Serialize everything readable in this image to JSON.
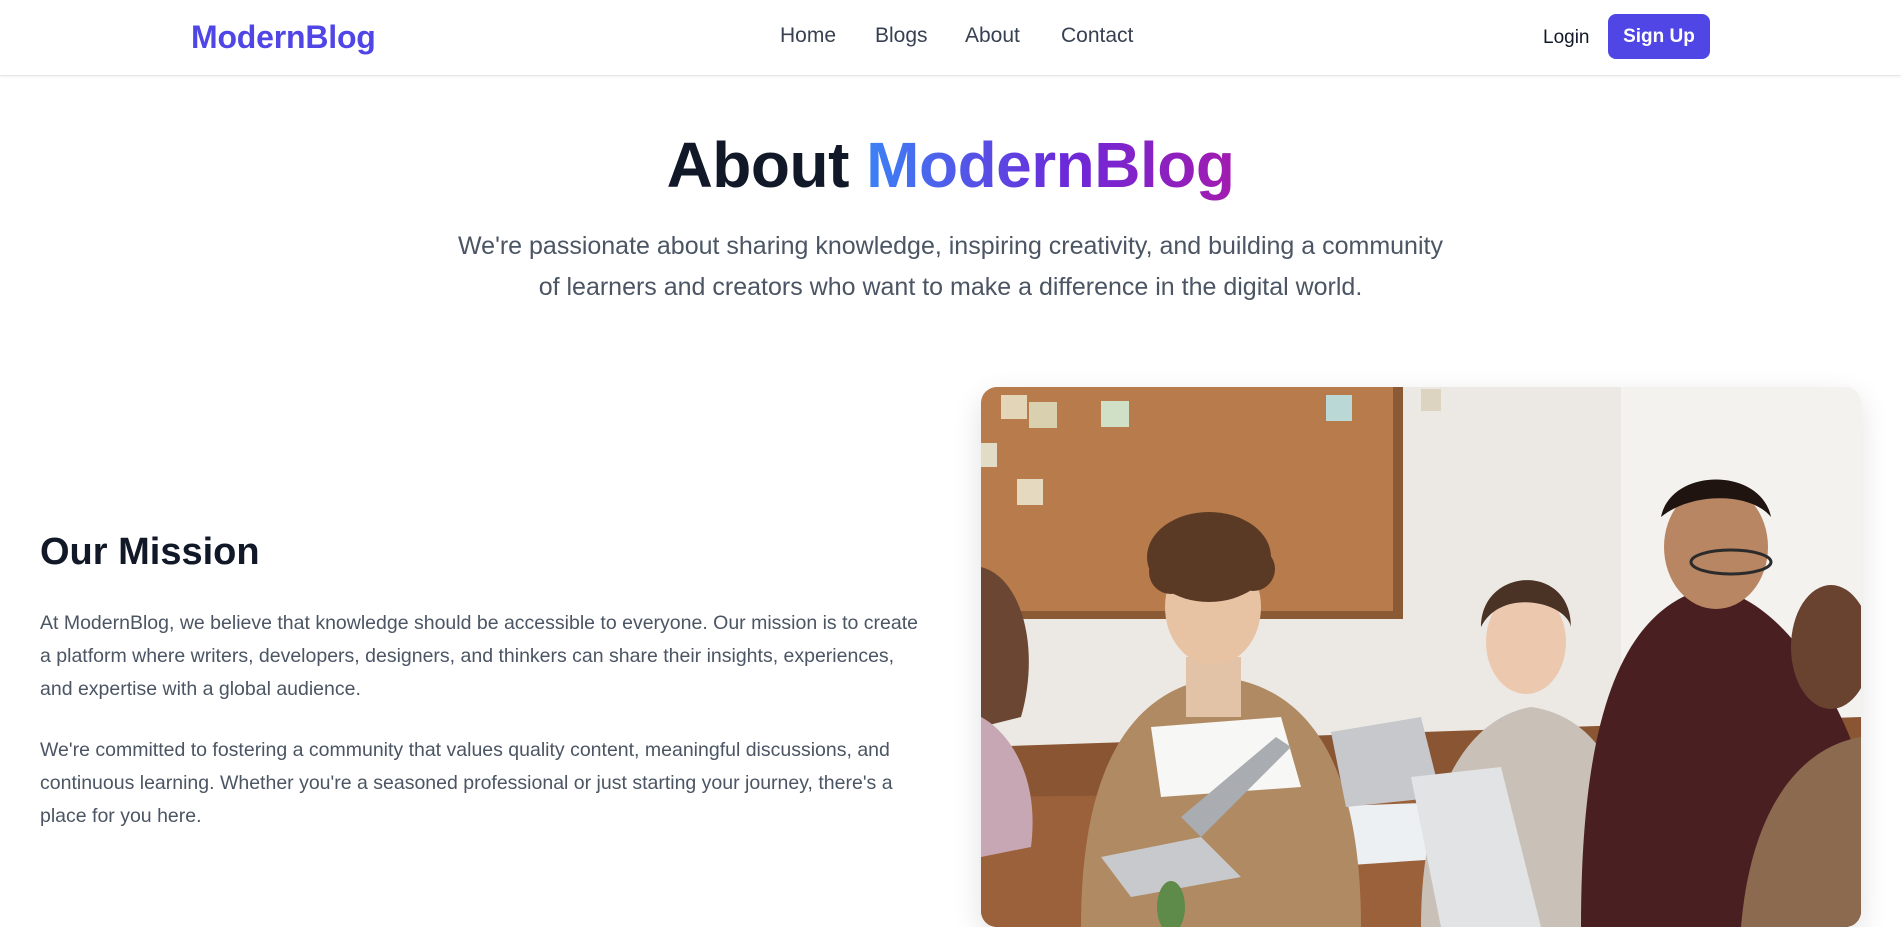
{
  "brand": {
    "name": "ModernBlog",
    "color": "#4f46e5"
  },
  "nav": {
    "links": [
      "Home",
      "Blogs",
      "About",
      "Contact"
    ]
  },
  "auth": {
    "login_label": "Login",
    "signup_label": "Sign Up"
  },
  "hero": {
    "title_prefix": "About",
    "title_accent": "ModernBlog",
    "subtitle": "We're passionate about sharing knowledge, inspiring creativity, and building a community of learners and creators who want to make a difference in the digital world."
  },
  "mission": {
    "title": "Our Mission",
    "paragraph_1": "At ModernBlog, we believe that knowledge should be accessible to everyone. Our mission is to create a platform where writers, developers, designers, and thinkers can share their insights, experiences, and expertise with a global audience.",
    "paragraph_2": "We're committed to fostering a community that values quality content, meaningful discussions, and continuous learning. Whether you're a seasoned professional or just starting your journey, there's a place for you here."
  },
  "colors": {
    "accent": "#4f46e5",
    "gradient_start": "#3b82f6",
    "gradient_end": "#a21caf",
    "heading": "#111827",
    "body_text": "#4b5563"
  }
}
